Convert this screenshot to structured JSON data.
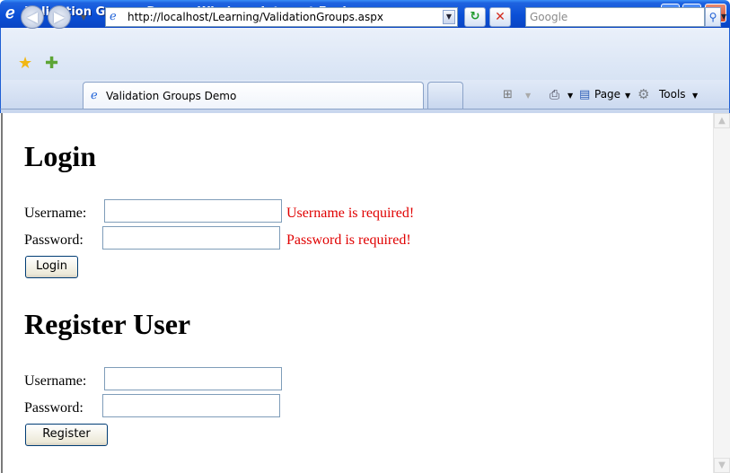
{
  "window": {
    "title": "Validation Groups Demo - Windows Internet Explorer"
  },
  "address_bar": {
    "url": "http://localhost/Learning/ValidationGroups.aspx",
    "search_placeholder": "Google"
  },
  "tabs": [
    {
      "label": "Validation Groups Demo",
      "active": true
    }
  ],
  "command_bar": {
    "page_label": "Page",
    "tools_label": "Tools"
  },
  "login": {
    "heading": "Login",
    "username_label": "Username:",
    "password_label": "Password:",
    "username_value": "",
    "password_value": "",
    "username_error": "Username is required!",
    "password_error": "Password is required!",
    "error_color": "#e00000",
    "button_label": "Login"
  },
  "register": {
    "heading": "Register User",
    "username_label": "Username:",
    "password_label": "Password:",
    "username_value": "",
    "password_value": "",
    "button_label": "Register"
  }
}
